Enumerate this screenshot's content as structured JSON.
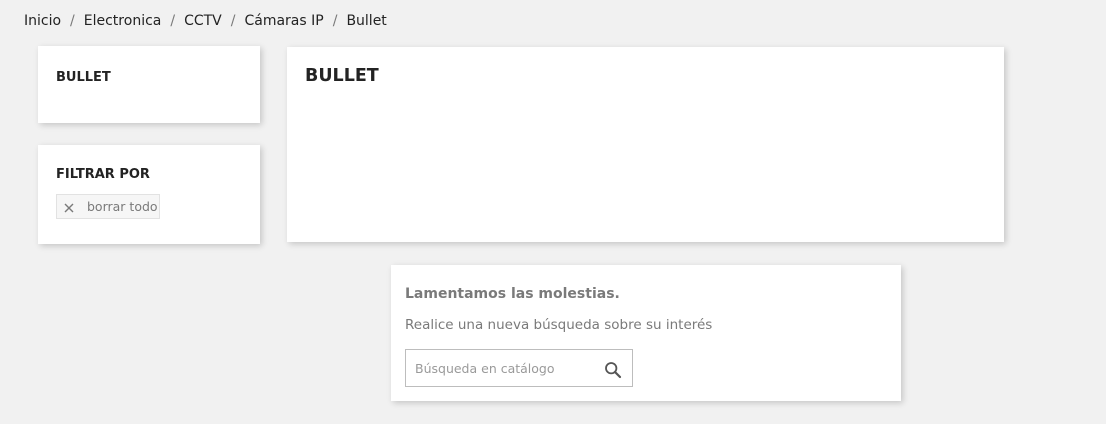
{
  "breadcrumb": {
    "items": [
      "Inicio",
      "Electronica",
      "CCTV",
      "Cámaras IP",
      "Bullet"
    ],
    "separator": "/"
  },
  "sidebar": {
    "category_title": "BULLET",
    "filter_title": "FILTRAR POR",
    "clear_all_label": "borrar todo",
    "clear_icon": "close-icon"
  },
  "category_header": {
    "title": "BULLET"
  },
  "not_found": {
    "heading": "Lamentamos las molestias.",
    "message": "Realice una nueva búsqueda sobre su interés",
    "search_placeholder": "Búsqueda en catálogo",
    "search_value": "",
    "search_icon": "search-icon"
  },
  "colors": {
    "background": "#f1f1f1",
    "card": "#ffffff",
    "text_dark": "#232323",
    "text_muted": "#7a7a7a"
  }
}
